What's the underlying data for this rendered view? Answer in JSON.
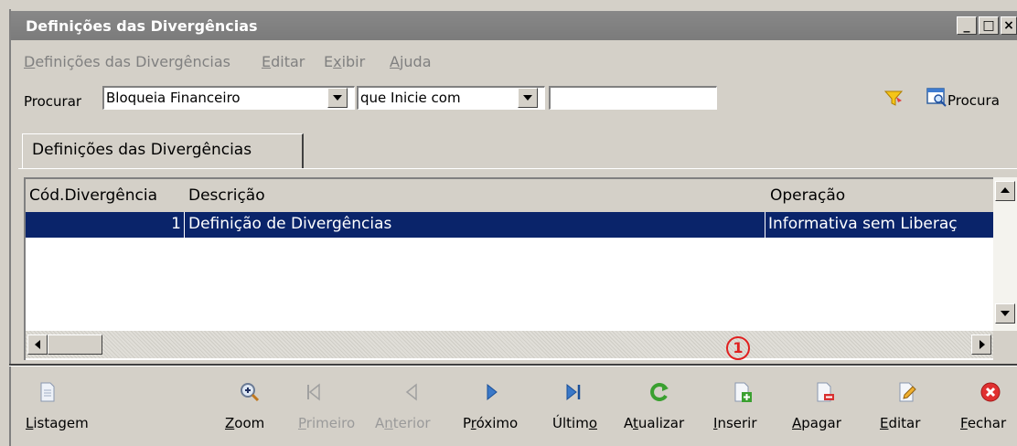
{
  "window": {
    "title": "Definições das Divergências",
    "controls": [
      "_",
      "□",
      "×"
    ]
  },
  "menu": [
    {
      "label": "Definições das Divergências",
      "underline_char": "D"
    },
    {
      "label": "Editar",
      "underline_char": "E"
    },
    {
      "label": "Exibir",
      "underline_char": "x"
    },
    {
      "label": "Ajuda",
      "underline_char": "A"
    }
  ],
  "search": {
    "label": "Procurar",
    "field": "Bloqueia Financeiro",
    "condition": "que Inicie com",
    "value": "",
    "search_button": "Procura"
  },
  "tab": {
    "label": "Definições das Divergências"
  },
  "grid": {
    "columns": [
      "Cód.Divergência",
      "Descrição",
      "Operação"
    ],
    "rows": [
      {
        "code": "1",
        "description": "Definição de Divergências",
        "operation": "Informativa sem Liberaç",
        "selected": true
      }
    ]
  },
  "marker": "1",
  "toolbar": [
    {
      "label": "Listagem",
      "underline": "L",
      "icon": "document-list-icon",
      "enabled": true
    },
    {
      "label": "Zoom",
      "underline": "Z",
      "icon": "zoom-icon",
      "enabled": true
    },
    {
      "label": "Primeiro",
      "underline": "P",
      "icon": "first-record-icon",
      "enabled": false
    },
    {
      "label": "Anterior",
      "underline": "n",
      "icon": "previous-record-icon",
      "enabled": false
    },
    {
      "label": "Próximo",
      "underline": "r",
      "icon": "next-record-icon",
      "enabled": true
    },
    {
      "label": "Último",
      "underline": "o",
      "icon": "last-record-icon",
      "enabled": true
    },
    {
      "label": "Atualizar",
      "underline": "t",
      "icon": "refresh-icon",
      "enabled": true
    },
    {
      "label": "Inserir",
      "underline": "I",
      "icon": "insert-icon",
      "enabled": true
    },
    {
      "label": "Apagar",
      "underline": "A",
      "icon": "delete-icon",
      "enabled": true
    },
    {
      "label": "Editar",
      "underline": "E",
      "icon": "edit-icon",
      "enabled": true
    },
    {
      "label": "Fechar",
      "underline": "F",
      "icon": "close-icon",
      "enabled": true
    }
  ],
  "colors": {
    "titlebar": "#7b7b7b",
    "selection": "#0a246a",
    "face": "#d4d0c8",
    "marker": "#e02020"
  }
}
